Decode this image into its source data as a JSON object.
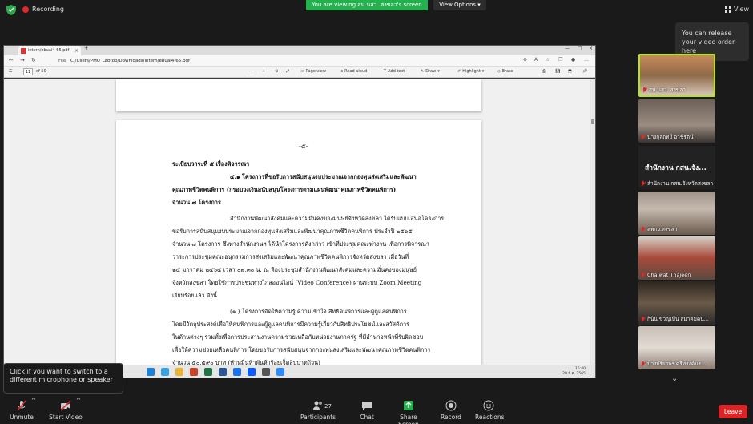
{
  "top": {
    "recording": "Recording",
    "viewing_banner": "You are viewing สน.นสว. สงขลา's screen",
    "view_options": "View Options",
    "view": "View"
  },
  "browser": {
    "tab_title": "intern/ebuai4-65.pdf",
    "url_label": "File",
    "url": "C:/Users/PMU_Labtop/Downloads/intern/ebuai4-65.pdf",
    "page_current": "11",
    "page_total": "of 50",
    "toolbar": {
      "minus": "−",
      "plus": "+",
      "page_view": "Page view",
      "read_aloud": "Read aloud",
      "add_text": "Add text",
      "draw": "Draw",
      "highlight": "Highlight",
      "erase": "Erase"
    },
    "taskbar_time": "15:40",
    "taskbar_date": "29 มี.ค. 2565"
  },
  "document": {
    "mark": "-๕-",
    "lines": [
      "ระเบียบวาระที่   ๕   เรื่องพิจารณา",
      "๕.๑ โครงการที่ขอรับการสนับสนุนงบประมาณจากกองทุนส่งเสริมและพัฒนา",
      "คุณภาพชีวิตคนพิการ (กรอบวงเงินสนับสนุนโครงการตามแผนพัฒนาคุณภาพชีวิตคนพิการ)",
      "จำนวน ๗ โครงการ",
      "สำนักงานพัฒนาสังคมและความมั่นคงของมนุษย์จังหวัดสงขลา ได้รับแบบเสนอโครงการ",
      "ขอรับการสนับสนุนงบประมาณจากกองทุนส่งเสริมและพัฒนาคุณภาพชีวิตคนพิการ ประจำปี ๒๕๖๕",
      "จำนวน ๗ โครงการ  ซึ่งทางสำนักงานฯ ได้นำโครงการดังกล่าว เข้าที่ประชุมคณะทำงาน เพื่อการพิจารณา",
      "วาระการประชุมคณะอนุกรรมการส่งเสริมและพัฒนาคุณภาพชีวิตคนพิการจังหวัดสงขลา เมื่อวันที่",
      "๒๕ มกราคม ๒๕๖๕ เวลา ๐๙.๓๐ น.  ณ  ห้องประชุมสำนักงานพัฒนาสังคมและความมั่นคงของมนุษย์",
      "จังหวัดสงขลา โดยใช้การประชุมทางไกลออนไลน์ (Video Conference) ผ่านระบบ Zoom Meeting",
      "เรียบร้อยแล้ว ดังนี้",
      "(๑.) โครงการจัดให้ความรู้ ความเข้าใจ สิทธิคนพิการและผู้ดูแลคนพิการ",
      "โดยมีวัตถุประสงค์เพื่อให้คนพิการและผู้ดูแลคนพิการมีความรู้เกี่ยวกับสิทธิประโยชน์และสวัสดิการ",
      "ในด้านต่างๆ รวมทั้งเพื่อการประสานงานความช่วยเหลือกับหน่วยงานภาครัฐ ที่มีอำนาจหน้าที่รับผิดชอบ",
      "เพื่อให้ความช่วยเหลือคนพิการ โดยขอรับการสนับสนุนจากกองทุนส่งเสริมและพัฒนาคุณภาพชีวิตคนพิการ",
      "จำนวน ๕๐,๕๙๐ บาท (ห้าหมื่นห้าพันห้าร้อยเจ็ดสิบบาทถ้วน)"
    ]
  },
  "tooltip": "Click if you want to switch to a different microphone or speaker",
  "release_tip": "You can release your video order here",
  "participants": [
    {
      "label": "สน.นสว. สงขลา"
    },
    {
      "label": "นางกุลฤทย์ อาชีรัตน์"
    },
    {
      "label": "สำนักงาน กสน.จังหวัดสงขลา",
      "big": "สำนักงาน กสน.จัง..."
    },
    {
      "label": "สพกจ.สงขลา"
    },
    {
      "label": "Chaiwat Thajeen"
    },
    {
      "label": "ก้นิน ขวัญเบ้น สมาคมคน..."
    },
    {
      "label": "นางปริยาพร ศรีทรงค์นร..."
    }
  ],
  "bottom": {
    "unmute": "Unmute",
    "start_video": "Start Video",
    "participants": "Participants",
    "participants_count": "27",
    "chat": "Chat",
    "share_screen": "Share Screen",
    "record": "Record",
    "reactions": "Reactions",
    "leave": "Leave"
  },
  "colors": {
    "green_banner": "#22b14c",
    "leave_red": "#d92525",
    "active_border": "#b5e61d",
    "muted_red": "#e02828"
  }
}
